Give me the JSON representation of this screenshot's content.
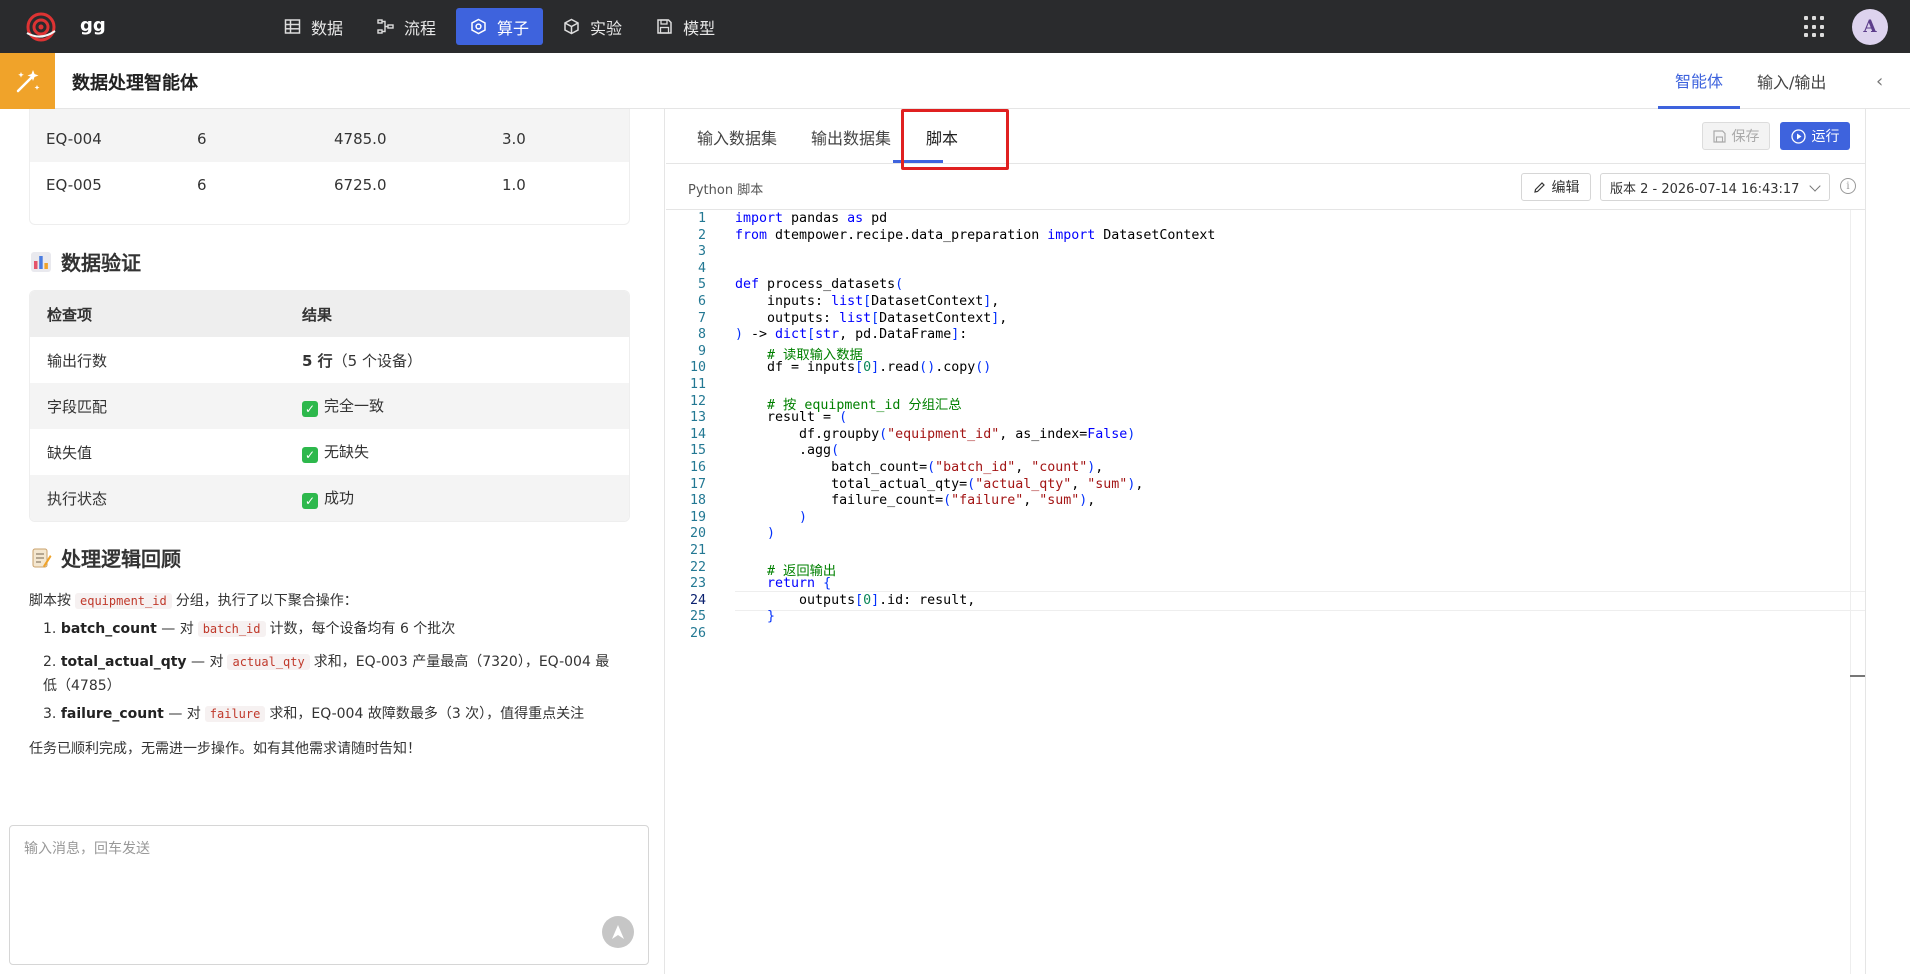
{
  "app": {
    "name": "gg"
  },
  "nav": [
    {
      "label": "数据",
      "icon": "table-icon"
    },
    {
      "label": "流程",
      "icon": "flow-icon"
    },
    {
      "label": "算子",
      "icon": "operator-icon",
      "active": true
    },
    {
      "label": "实验",
      "icon": "cube-icon"
    },
    {
      "label": "模型",
      "icon": "save-icon"
    }
  ],
  "user": {
    "avatar": "A"
  },
  "header": {
    "title": "数据处理智能体",
    "tabs": [
      "智能体",
      "输入/输出"
    ],
    "active_tab": "智能体"
  },
  "left": {
    "top_table": {
      "rows": [
        [
          "EQ-004",
          "6",
          "4785.0",
          "3.0"
        ],
        [
          "EQ-005",
          "6",
          "6725.0",
          "1.0"
        ]
      ]
    },
    "validation": {
      "title": "数据验证",
      "headers": [
        "检查项",
        "结果"
      ],
      "rows": [
        {
          "item": "输出行数",
          "result_bold": "5 行",
          "result": "（5 个设备）"
        },
        {
          "item": "字段匹配",
          "result": "完全一致",
          "check": true
        },
        {
          "item": "缺失值",
          "result": "无缺失",
          "check": true
        },
        {
          "item": "执行状态",
          "result": "成功",
          "check": true
        }
      ]
    },
    "review": {
      "title": "处理逻辑回顾",
      "intro_pre": "脚本按",
      "intro_code": "equipment_id",
      "intro_post": "分组，执行了以下聚合操作：",
      "items": [
        {
          "num": "1.",
          "name": "batch_count",
          "dash": "— 对",
          "code": "batch_id",
          "text": "计数，每个设备均有 6 个批次"
        },
        {
          "num": "2.",
          "name": "total_actual_qty",
          "dash": "— 对",
          "code": "actual_qty",
          "text": "求和，EQ-003 产量最高（7320），EQ-004 最低（4785）"
        },
        {
          "num": "3.",
          "name": "failure_count",
          "dash": "— 对",
          "code": "failure",
          "text": "求和，EQ-004 故障数最多（3 次），值得重点关注"
        }
      ],
      "closing": "任务已顺利完成，无需进一步操作。如有其他需求请随时告知！"
    },
    "chat": {
      "placeholder": "输入消息，回车发送"
    }
  },
  "right": {
    "tabs": [
      "输入数据集",
      "输出数据集",
      "脚本"
    ],
    "active_tab": "脚本",
    "save_label": "保存",
    "run_label": "运行",
    "script_label": "Python 脚本",
    "edit_label": "编辑",
    "version": "版本 2 - 2026-07-14 16:43:17",
    "current_line": 24
  },
  "code_lines": [
    "import pandas as pd",
    "from dtempower.recipe.data_preparation import DatasetContext",
    "",
    "",
    "def process_datasets(",
    "    inputs: list[DatasetContext],",
    "    outputs: list[DatasetContext],",
    ") -> dict[str, pd.DataFrame]:",
    "    # 读取输入数据",
    "    df = inputs[0].read().copy()",
    "",
    "    # 按 equipment_id 分组汇总",
    "    result = (",
    "        df.groupby(\"equipment_id\", as_index=False)",
    "        .agg(",
    "            batch_count=(\"batch_id\", \"count\"),",
    "            total_actual_qty=(\"actual_qty\", \"sum\"),",
    "            failure_count=(\"failure\", \"sum\"),",
    "        )",
    "    )",
    "",
    "    # 返回输出",
    "    return {",
    "        outputs[0].id: result,",
    "    }",
    ""
  ],
  "colors": {
    "accent": "#3e63dd",
    "topbar": "#2a2b2d",
    "badge": "#f0a32a",
    "highlight": "#e02020"
  }
}
